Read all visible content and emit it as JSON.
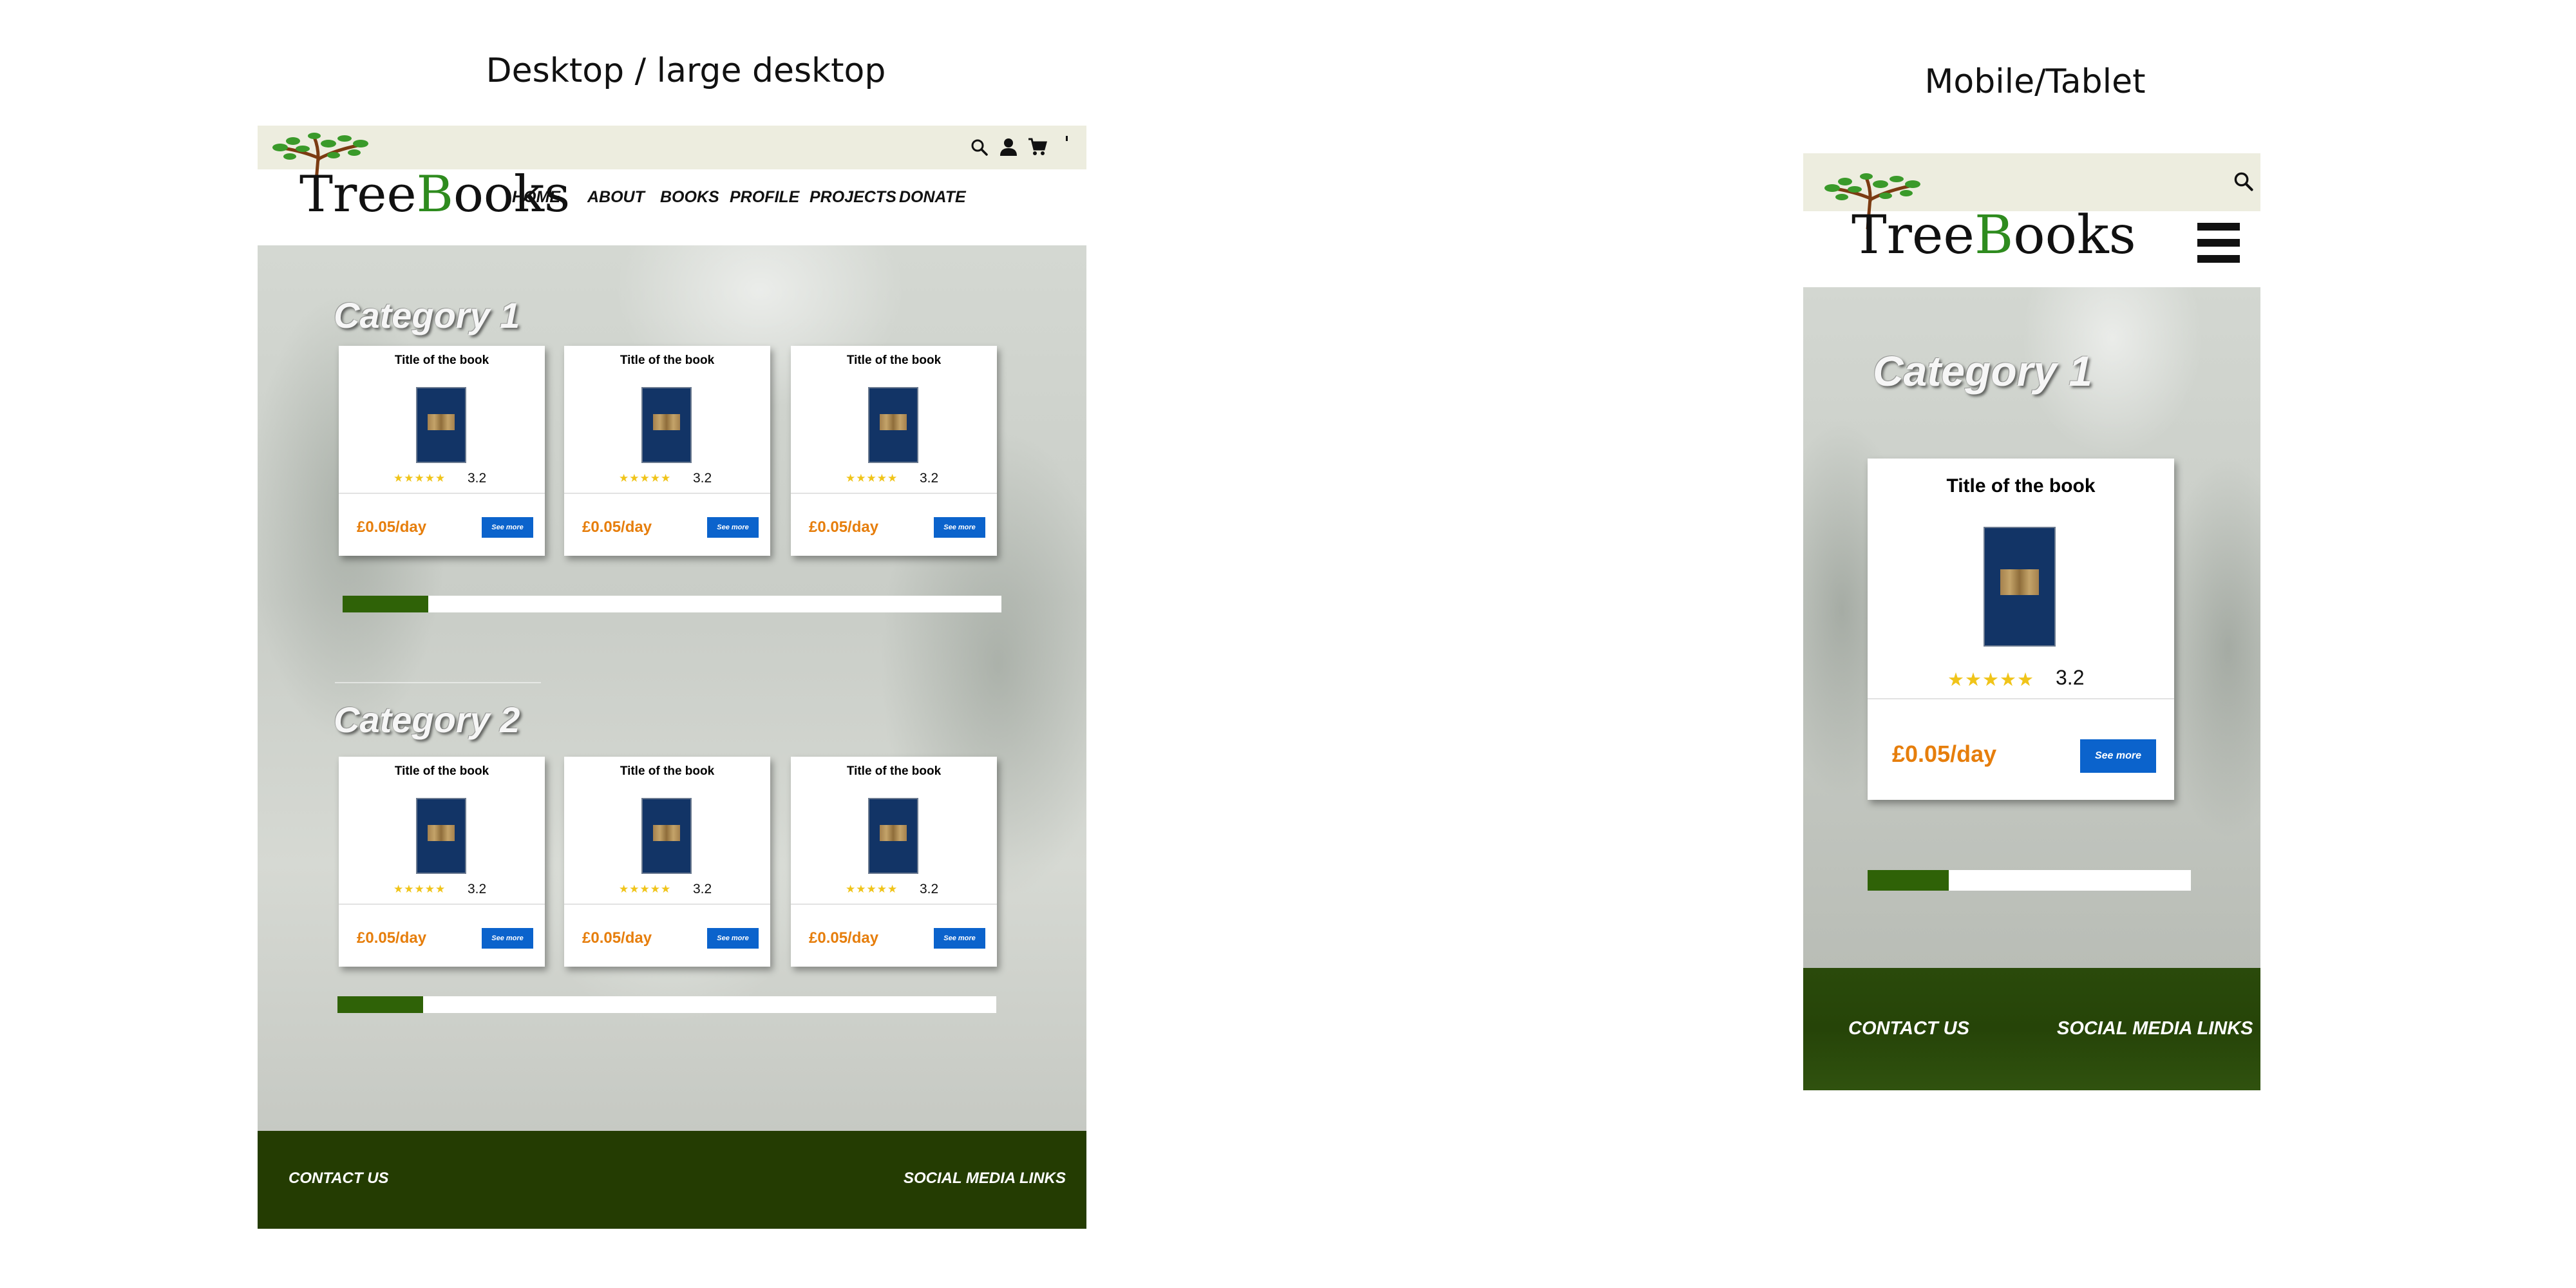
{
  "headings": {
    "desktop": "Desktop / large desktop",
    "mobile": "Mobile/Tablet"
  },
  "brand": {
    "logo_text_1": "Tree",
    "logo_text_b": "B",
    "logo_text_2": "ooks"
  },
  "desktop": {
    "nav": [
      "HOME",
      "ABOUT",
      "BOOKS",
      "PROFILE",
      "PROJECTS",
      "DONATE"
    ],
    "categories": [
      {
        "title": "Category 1",
        "progress": 0.13,
        "cards": [
          {
            "title": "Title of the book",
            "stars": "★★★★★",
            "rating": "3.2",
            "price": "£0.05/day",
            "button": "See more"
          },
          {
            "title": "Title of the book",
            "stars": "★★★★★",
            "rating": "3.2",
            "price": "£0.05/day",
            "button": "See more"
          },
          {
            "title": "Title of the book",
            "stars": "★★★★★",
            "rating": "3.2",
            "price": "£0.05/day",
            "button": "See more"
          }
        ]
      },
      {
        "title": "Category 2",
        "progress": 0.13,
        "cards": [
          {
            "title": "Title of the book",
            "stars": "★★★★★",
            "rating": "3.2",
            "price": "£0.05/day",
            "button": "See more"
          },
          {
            "title": "Title of the book",
            "stars": "★★★★★",
            "rating": "3.2",
            "price": "£0.05/day",
            "button": "See more"
          },
          {
            "title": "Title of the book",
            "stars": "★★★★★",
            "rating": "3.2",
            "price": "£0.05/day",
            "button": "See more"
          }
        ]
      }
    ],
    "footer": {
      "contact": "CONTACT US",
      "social": "SOCIAL MEDIA LINKS"
    }
  },
  "mobile": {
    "category": {
      "title": "Category 1",
      "progress": 0.25,
      "card": {
        "title": "Title of the book",
        "stars": "★★★★★",
        "rating": "3.2",
        "price": "£0.05/day",
        "button": "See more"
      }
    },
    "footer": {
      "contact": "CONTACT US",
      "social": "SOCIAL MEDIA LINKS"
    }
  },
  "icons": [
    "search-icon",
    "user-icon",
    "cart-icon",
    "hamburger-menu-icon"
  ],
  "colors": {
    "topbar": "#ededdf",
    "footer": "#243c02",
    "progress_fill": "#2f6207",
    "price": "#e67e0c",
    "button": "#0b63cc",
    "stars": "#f0c419",
    "cover": "#123466"
  }
}
